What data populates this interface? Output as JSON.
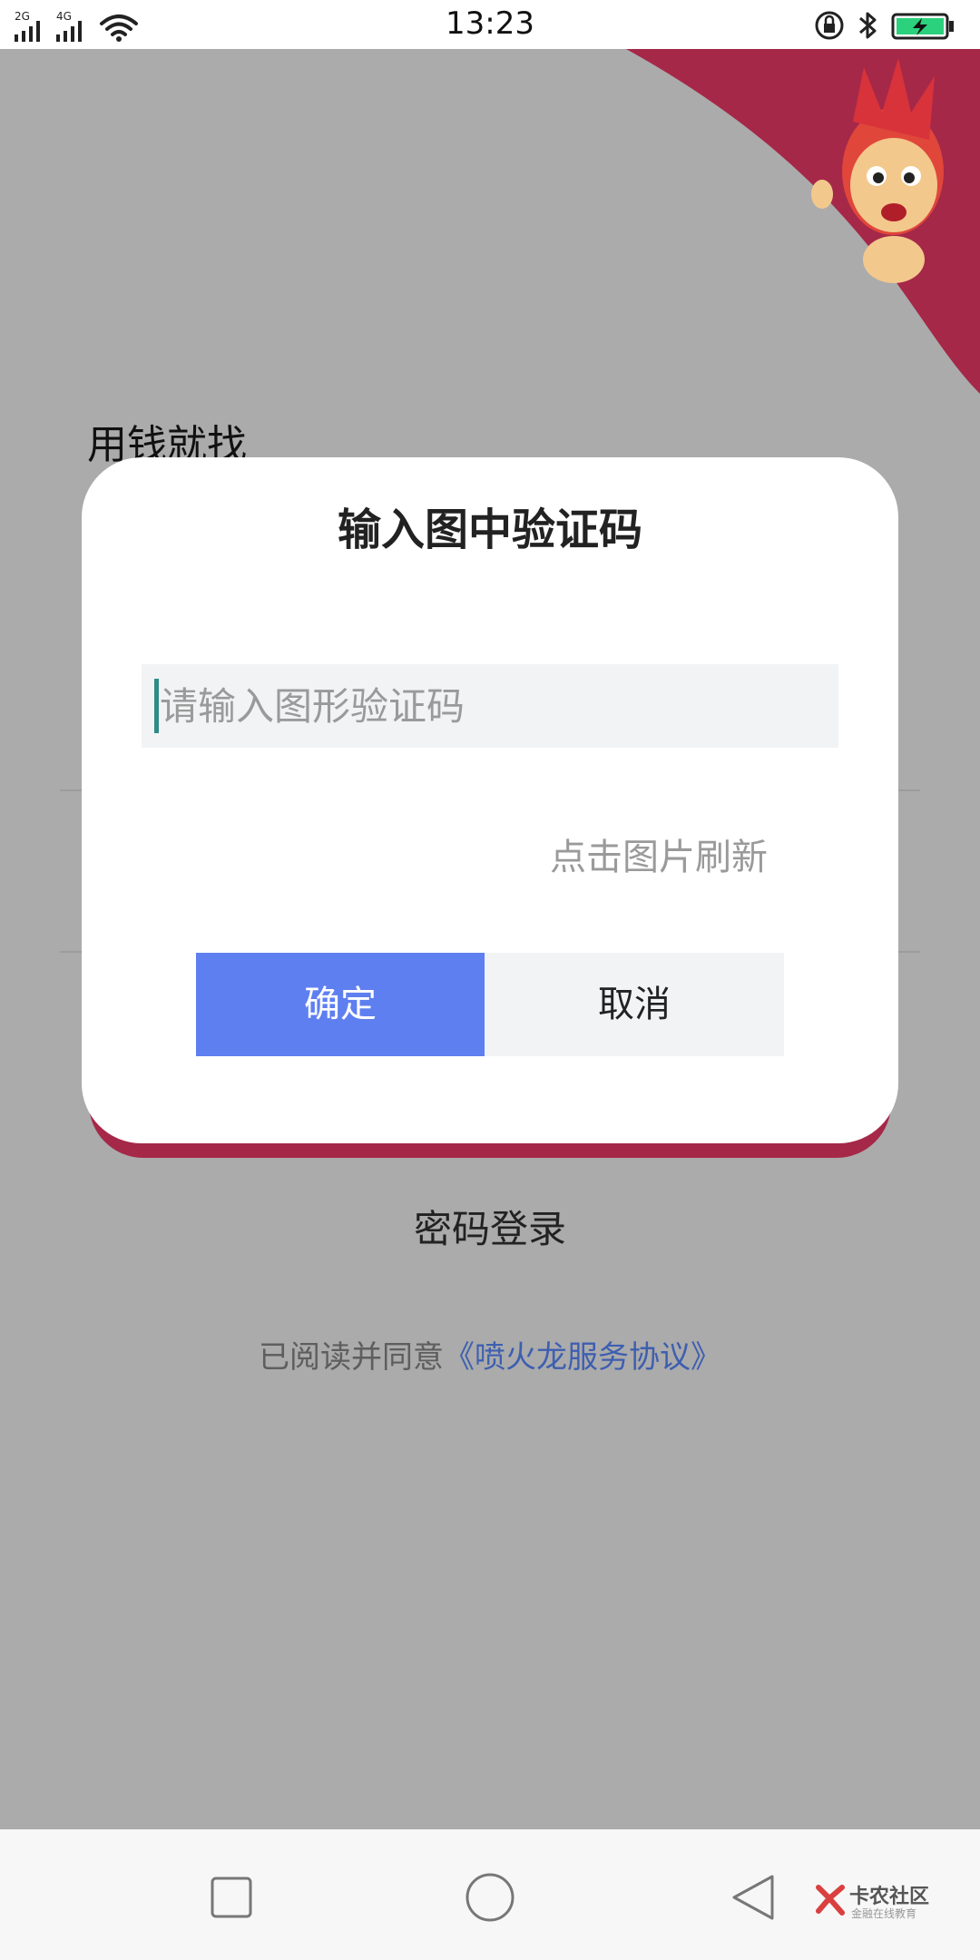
{
  "status_bar": {
    "network_1": "2G",
    "network_2": "4G",
    "time": "13:23",
    "icons": [
      "signal-icon",
      "wifi-icon",
      "rotation-lock-icon",
      "bluetooth-icon",
      "battery-charging-icon"
    ]
  },
  "background_page": {
    "slogan": "用钱就找",
    "password_login": "密码登录",
    "agreement_prefix": "已阅读并同意",
    "agreement_link": "《喷火龙服务协议》",
    "mascot_icon": "dragon-mascot-icon"
  },
  "captcha_dialog": {
    "title": "输入图中验证码",
    "input_placeholder": "请输入图形验证码",
    "input_value": "",
    "refresh_hint": "点击图片刷新",
    "confirm_label": "确定",
    "cancel_label": "取消"
  },
  "nav_bar": {
    "icons": [
      "recent-apps-icon",
      "home-icon",
      "back-icon"
    ],
    "watermark_title": "卡农社区",
    "watermark_subtitle": "金融在线教育"
  },
  "colors": {
    "accent_red": "#a52849",
    "confirm_blue": "#5e7ff0",
    "link_blue": "#3e5fb0",
    "overlay_gray": "#ababab",
    "caret_teal": "#2e8b87"
  }
}
